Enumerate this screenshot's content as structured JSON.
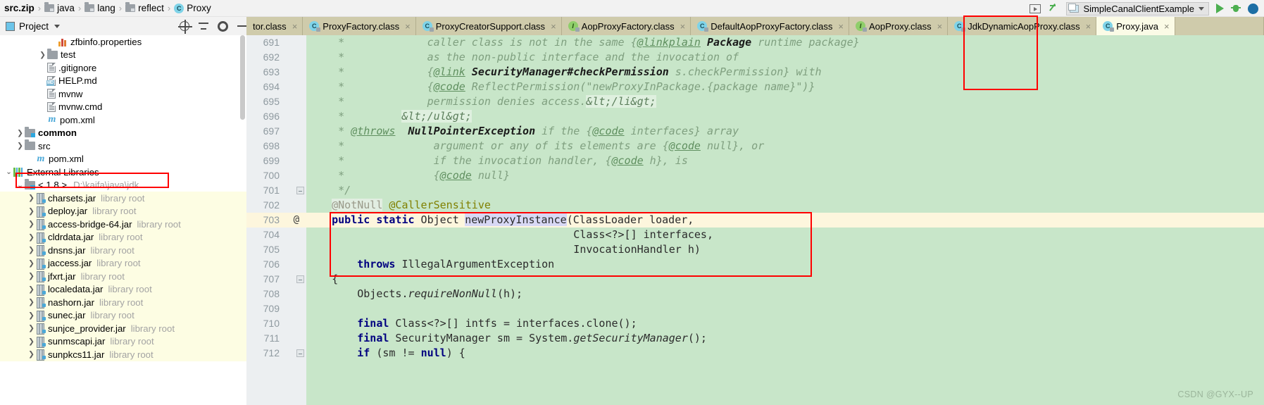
{
  "breadcrumb": {
    "root": "src.zip",
    "items": [
      {
        "label": "java",
        "icon": "folder-icon"
      },
      {
        "label": "lang",
        "icon": "folder-icon"
      },
      {
        "label": "reflect",
        "icon": "folder-icon"
      },
      {
        "label": "Proxy",
        "icon": "class-icon"
      }
    ],
    "separator": "›"
  },
  "toolbar": {
    "run_config": "SimpleCanalClientExample",
    "icons": [
      "run-anything-icon",
      "build-icon",
      "run-icon",
      "debug-icon",
      "profile-icon"
    ]
  },
  "project_panel": {
    "title": "Project",
    "caret": "▾",
    "actions": [
      "locate-icon",
      "collapse-all-icon",
      "settings-icon",
      "hide-icon"
    ]
  },
  "tree": [
    {
      "indent": 4,
      "arrow": "",
      "icon": "properties-icon",
      "name": "zfbinfo.properties",
      "hint": "",
      "highlight": false
    },
    {
      "indent": 3,
      "arrow": "❯",
      "icon": "folder-icon",
      "name": "test",
      "hint": "",
      "highlight": false
    },
    {
      "indent": 3,
      "arrow": "",
      "icon": "file-icon",
      "name": ".gitignore",
      "hint": "",
      "highlight": false
    },
    {
      "indent": 3,
      "arrow": "",
      "icon": "markdown-icon",
      "name": "HELP.md",
      "hint": "",
      "highlight": false
    },
    {
      "indent": 3,
      "arrow": "",
      "icon": "file-icon",
      "name": "mvnw",
      "hint": "",
      "highlight": false
    },
    {
      "indent": 3,
      "arrow": "",
      "icon": "file-icon",
      "name": "mvnw.cmd",
      "hint": "",
      "highlight": false
    },
    {
      "indent": 3,
      "arrow": "",
      "icon": "maven-icon",
      "name": "pom.xml",
      "hint": "",
      "highlight": false
    },
    {
      "indent": 1,
      "arrow": "❯",
      "icon": "module-folder-icon",
      "name": "common",
      "hint": "",
      "bold": true,
      "highlight": false
    },
    {
      "indent": 1,
      "arrow": "❯",
      "icon": "folder-icon",
      "name": "src",
      "hint": "",
      "highlight": false
    },
    {
      "indent": 2,
      "arrow": "",
      "icon": "maven-icon",
      "name": "pom.xml",
      "hint": "",
      "highlight": false
    },
    {
      "indent": 0,
      "arrow": "⌄",
      "icon": "external-libraries-icon",
      "name": "External Libraries",
      "hint": "",
      "highlight": false
    },
    {
      "indent": 1,
      "arrow": "⌄",
      "icon": "jdk-icon",
      "name": "< 1.8 >",
      "path": "D:\\kaifa\\java\\jdk",
      "hint": "",
      "highlight": false
    },
    {
      "indent": 2,
      "arrow": "❯",
      "icon": "jar-icon",
      "name": "charsets.jar",
      "hint": "library root",
      "highlight": true
    },
    {
      "indent": 2,
      "arrow": "❯",
      "icon": "jar-icon",
      "name": "deploy.jar",
      "hint": "library root",
      "highlight": true
    },
    {
      "indent": 2,
      "arrow": "❯",
      "icon": "jar-icon",
      "name": "access-bridge-64.jar",
      "hint": "library root",
      "highlight": true
    },
    {
      "indent": 2,
      "arrow": "❯",
      "icon": "jar-icon",
      "name": "cldrdata.jar",
      "hint": "library root",
      "highlight": true
    },
    {
      "indent": 2,
      "arrow": "❯",
      "icon": "jar-icon",
      "name": "dnsns.jar",
      "hint": "library root",
      "highlight": true
    },
    {
      "indent": 2,
      "arrow": "❯",
      "icon": "jar-icon",
      "name": "jaccess.jar",
      "hint": "library root",
      "highlight": true
    },
    {
      "indent": 2,
      "arrow": "❯",
      "icon": "jar-icon",
      "name": "jfxrt.jar",
      "hint": "library root",
      "highlight": true
    },
    {
      "indent": 2,
      "arrow": "❯",
      "icon": "jar-icon",
      "name": "localedata.jar",
      "hint": "library root",
      "highlight": true
    },
    {
      "indent": 2,
      "arrow": "❯",
      "icon": "jar-icon",
      "name": "nashorn.jar",
      "hint": "library root",
      "highlight": true
    },
    {
      "indent": 2,
      "arrow": "❯",
      "icon": "jar-icon",
      "name": "sunec.jar",
      "hint": "library root",
      "highlight": true
    },
    {
      "indent": 2,
      "arrow": "❯",
      "icon": "jar-icon",
      "name": "sunjce_provider.jar",
      "hint": "library root",
      "highlight": true
    },
    {
      "indent": 2,
      "arrow": "❯",
      "icon": "jar-icon",
      "name": "sunmscapi.jar",
      "hint": "library root",
      "highlight": true
    },
    {
      "indent": 2,
      "arrow": "❯",
      "icon": "jar-icon",
      "name": "sunpkcs11.jar",
      "hint": "library root",
      "highlight": true
    }
  ],
  "tabs": [
    {
      "label": "tor.class",
      "icon": "class-icon",
      "active": false,
      "truncated": true
    },
    {
      "label": "ProxyFactory.class",
      "icon": "class-icon",
      "active": false
    },
    {
      "label": "ProxyCreatorSupport.class",
      "icon": "class-icon",
      "active": false
    },
    {
      "label": "AopProxyFactory.class",
      "icon": "interface-icon",
      "active": false
    },
    {
      "label": "DefaultAopProxyFactory.class",
      "icon": "class-icon",
      "active": false
    },
    {
      "label": "AopProxy.class",
      "icon": "interface-icon",
      "active": false
    },
    {
      "label": "JdkDynamicAopProxy.class",
      "icon": "class-icon",
      "active": false
    },
    {
      "label": "Proxy.java",
      "icon": "class-icon",
      "active": true
    }
  ],
  "tab_close_glyph": "×",
  "editor": {
    "first_line": 691,
    "lines": [
      {
        "num": 691,
        "type": "comment"
      },
      {
        "num": 692,
        "type": "comment"
      },
      {
        "num": 693,
        "type": "comment"
      },
      {
        "num": 694,
        "type": "comment"
      },
      {
        "num": 695,
        "type": "comment"
      },
      {
        "num": 696,
        "type": "comment"
      },
      {
        "num": 697,
        "type": "comment"
      },
      {
        "num": 698,
        "type": "comment"
      },
      {
        "num": 699,
        "type": "comment"
      },
      {
        "num": 700,
        "type": "comment"
      },
      {
        "num": 701,
        "type": "comment"
      },
      {
        "num": 702,
        "type": "annotation"
      },
      {
        "num": 703,
        "type": "code",
        "highlight": true,
        "gutter_marker": "@"
      },
      {
        "num": 704,
        "type": "code"
      },
      {
        "num": 705,
        "type": "code"
      },
      {
        "num": 706,
        "type": "code"
      },
      {
        "num": 707,
        "type": "code"
      },
      {
        "num": 708,
        "type": "code"
      },
      {
        "num": 709,
        "type": "code"
      },
      {
        "num": 710,
        "type": "code"
      },
      {
        "num": 711,
        "type": "code"
      },
      {
        "num": 712,
        "type": "code"
      }
    ],
    "text_lines": [
      "     *             caller class is not in the same {@linkplain Package runtime package}",
      "     *             as the non-public interface and the invocation of",
      "     *             {@link SecurityManager#checkPermission s.checkPermission} with",
      "     *             {@code ReflectPermission(\"newProxyInPackage.{package name}\")}",
      "     *             permission denies access.</li>",
      "     *         </ul>",
      "     * @throws  NullPointerException if the {@code interfaces} array",
      "     *              argument or any of its elements are {@code null}, or",
      "     *              if the invocation handler, {@code h}, is",
      "     *              {@code null}",
      "     */",
      "    @NotNull @CallerSensitive",
      "    public static Object newProxyInstance(ClassLoader loader,",
      "                                          Class<?>[] interfaces,",
      "                                          InvocationHandler h)",
      "        throws IllegalArgumentException",
      "    {",
      "        Objects.requireNonNull(h);",
      "",
      "        final Class<?>[] intfs = interfaces.clone();",
      "        final SecurityManager sm = System.getSecurityManager();",
      "        if (sm != null) {"
    ],
    "selected_token": "newProxyInstance",
    "caret_position_token": "newProxyInstance"
  },
  "annotations": {
    "red_boxes": [
      {
        "name": "method-signature-highlight"
      },
      {
        "name": "jdk-entry-highlight"
      },
      {
        "name": "active-tab-highlight"
      }
    ]
  },
  "watermark": "CSDN @GYX--UP",
  "colors": {
    "editor_background": "#c8e6c9",
    "tabbar_background": "#cfcbab",
    "active_tab_background": "#fbfbe6",
    "highlight_line": "#fdf6dd",
    "annotation_red": "#ff0000",
    "tree_highlight": "#fdfde3",
    "keyword_blue": "#000080"
  }
}
